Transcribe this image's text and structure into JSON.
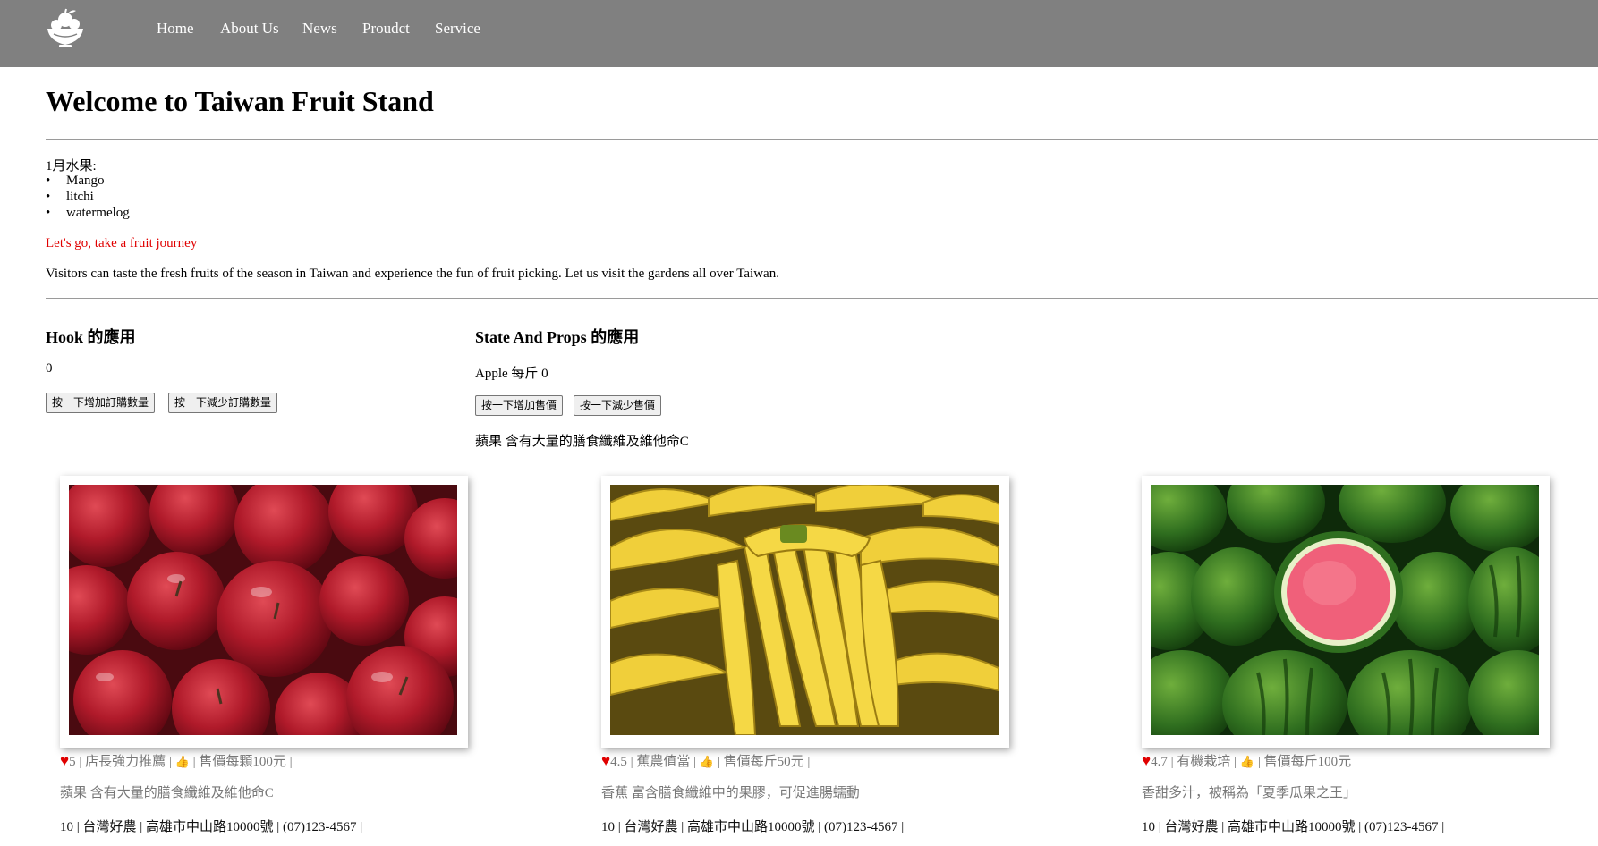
{
  "nav": {
    "items": [
      "Home",
      "About Us",
      "News",
      "Proudct",
      "Service"
    ]
  },
  "header": {
    "title": "Welcome to Taiwan Fruit Stand"
  },
  "intro": {
    "month_label": "1月水果:",
    "fruits": [
      "Mango",
      "litchi",
      "watermelog"
    ],
    "journey": "Let's go, take a fruit journey",
    "visitors": "Visitors can taste the fresh fruits of the season in Taiwan and experience the fun of fruit picking. Let us visit the gardens all over Taiwan."
  },
  "hook": {
    "heading": "Hook 的應用",
    "count": "0",
    "increase_label": "按一下增加訂購數量",
    "decrease_label": "按一下減少訂購數量"
  },
  "state_props": {
    "heading": "State And Props 的應用",
    "price_text": "Apple 每斤 0",
    "increase_label": "按一下增加售價",
    "decrease_label": "按一下減少售價",
    "description": "蘋果 含有大量的膳食纖維及維他命C"
  },
  "cards": [
    {
      "image": "apples-photo",
      "rating": "5",
      "tag": "店長強力推薦",
      "price": "售價每顆100元",
      "description": "蘋果 含有大量的膳食纖維及維他命C",
      "footer": "10 | 台灣好農 | 高雄市中山路10000號 | (07)123-4567 |"
    },
    {
      "image": "bananas-photo",
      "rating": "4.5",
      "tag": "蕉農值當",
      "price": "售價每斤50元",
      "description": "香蕉 富含膳食纖維中的果膠，可促進腸蠕動",
      "footer": "10 | 台灣好農 | 高雄市中山路10000號 | (07)123-4567 |"
    },
    {
      "image": "watermelons-photo",
      "rating": "4.7",
      "tag": "有機栽培",
      "price": "售價每斤100元",
      "description": "香甜多汁，被稱為「夏季瓜果之王」",
      "footer": "10 | 台灣好農 | 高雄市中山路10000號 | (07)123-4567 |"
    }
  ],
  "colors": {
    "navbar": "#808080",
    "journey": "#e00000",
    "heart": "#e00000",
    "thumb": "#1a6fd6"
  }
}
